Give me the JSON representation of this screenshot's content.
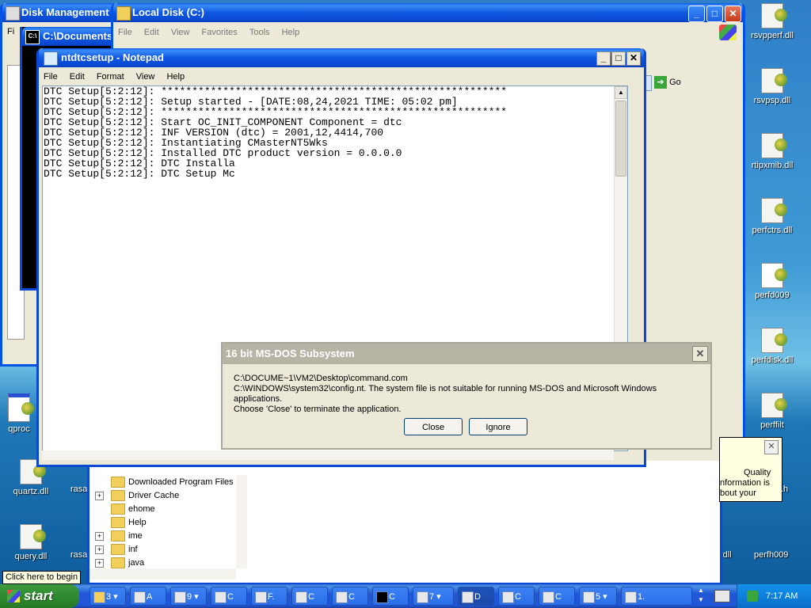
{
  "desktop_icons_right": [
    {
      "label": "rsvpperf.dll"
    },
    {
      "label": "rsvpsp.dll"
    },
    {
      "label": "rtipxmib.dll"
    },
    {
      "label": "perfctrs.dll"
    },
    {
      "label": "perfd009"
    },
    {
      "label": "perfdisk.dll"
    },
    {
      "label": "perffilt"
    }
  ],
  "desktop_icons_left": [
    {
      "label": "qproc"
    },
    {
      "label": "quartz.dll"
    },
    {
      "label": "query.dll"
    },
    {
      "label": "rasa"
    },
    {
      "label": "rasa"
    }
  ],
  "desktop_partial_labels": [
    "rdll",
    "perfh009"
  ],
  "disk_mgmt": {
    "title": "Disk Management",
    "menu_first": "Fi"
  },
  "cmd_window": {
    "title": "C:\\Documents"
  },
  "explorer": {
    "title": "Local Disk (C:)",
    "menu": [
      "File",
      "Edit",
      "View",
      "Favorites",
      "Tools",
      "Help"
    ],
    "go_label": "Go",
    "tree": [
      {
        "label": "Downloaded Program Files",
        "expand": ""
      },
      {
        "label": "Driver Cache",
        "expand": "+"
      },
      {
        "label": "ehome",
        "expand": ""
      },
      {
        "label": "Help",
        "expand": ""
      },
      {
        "label": "ime",
        "expand": "+"
      },
      {
        "label": "inf",
        "expand": "+"
      },
      {
        "label": "java",
        "expand": "+"
      }
    ]
  },
  "balloon": {
    "lines": [
      "Quality",
      "nformation is",
      "bout your"
    ],
    "suffix": ".h"
  },
  "notepad": {
    "title": "ntdtcsetup - Notepad",
    "menu": [
      "File",
      "Edit",
      "Format",
      "View",
      "Help"
    ],
    "lines": [
      "DTC Setup[5:2:12]: ********************************************************",
      "DTC Setup[5:2:12]: Setup started - [DATE:08,24,2021 TIME: 05:02 pm]",
      "DTC Setup[5:2:12]: ********************************************************",
      "DTC Setup[5:2:12]: Start OC_INIT_COMPONENT Component = dtc",
      "DTC Setup[5:2:12]: INF VERSION (dtc) = 2001,12,4414,700",
      "DTC Setup[5:2:12]: Instantiating CMasterNT5Wks",
      "DTC Setup[5:2:12]: Installed DTC product version = 0.0.0.0",
      "DTC Setup[5:2:12]: DTC Installa",
      "DTC Setup[5:2:12]: DTC Setup Mc"
    ]
  },
  "dialog": {
    "title": "16 bit MS-DOS Subsystem",
    "line1": "C:\\DOCUME~1\\VM2\\Desktop\\command.com",
    "line2": "C:\\WINDOWS\\system32\\config.nt. The system file is not suitable for running MS-DOS and Microsoft Windows applications.",
    "line3": "Choose 'Close' to terminate the application.",
    "close_label": "Close",
    "ignore_label": "Ignore"
  },
  "tooltip": "Click here to begin",
  "taskbar": {
    "start_label": "start",
    "items": [
      {
        "label": "3"
      },
      {
        "label": "A"
      },
      {
        "label": "9"
      },
      {
        "label": "C"
      },
      {
        "label": "F."
      },
      {
        "label": "C"
      },
      {
        "label": "C"
      },
      {
        "label": "C"
      },
      {
        "label": "7"
      },
      {
        "label": "D"
      },
      {
        "label": "C"
      },
      {
        "label": "C"
      },
      {
        "label": "5"
      },
      {
        "label": "1."
      }
    ],
    "clock": "7:17 AM"
  }
}
